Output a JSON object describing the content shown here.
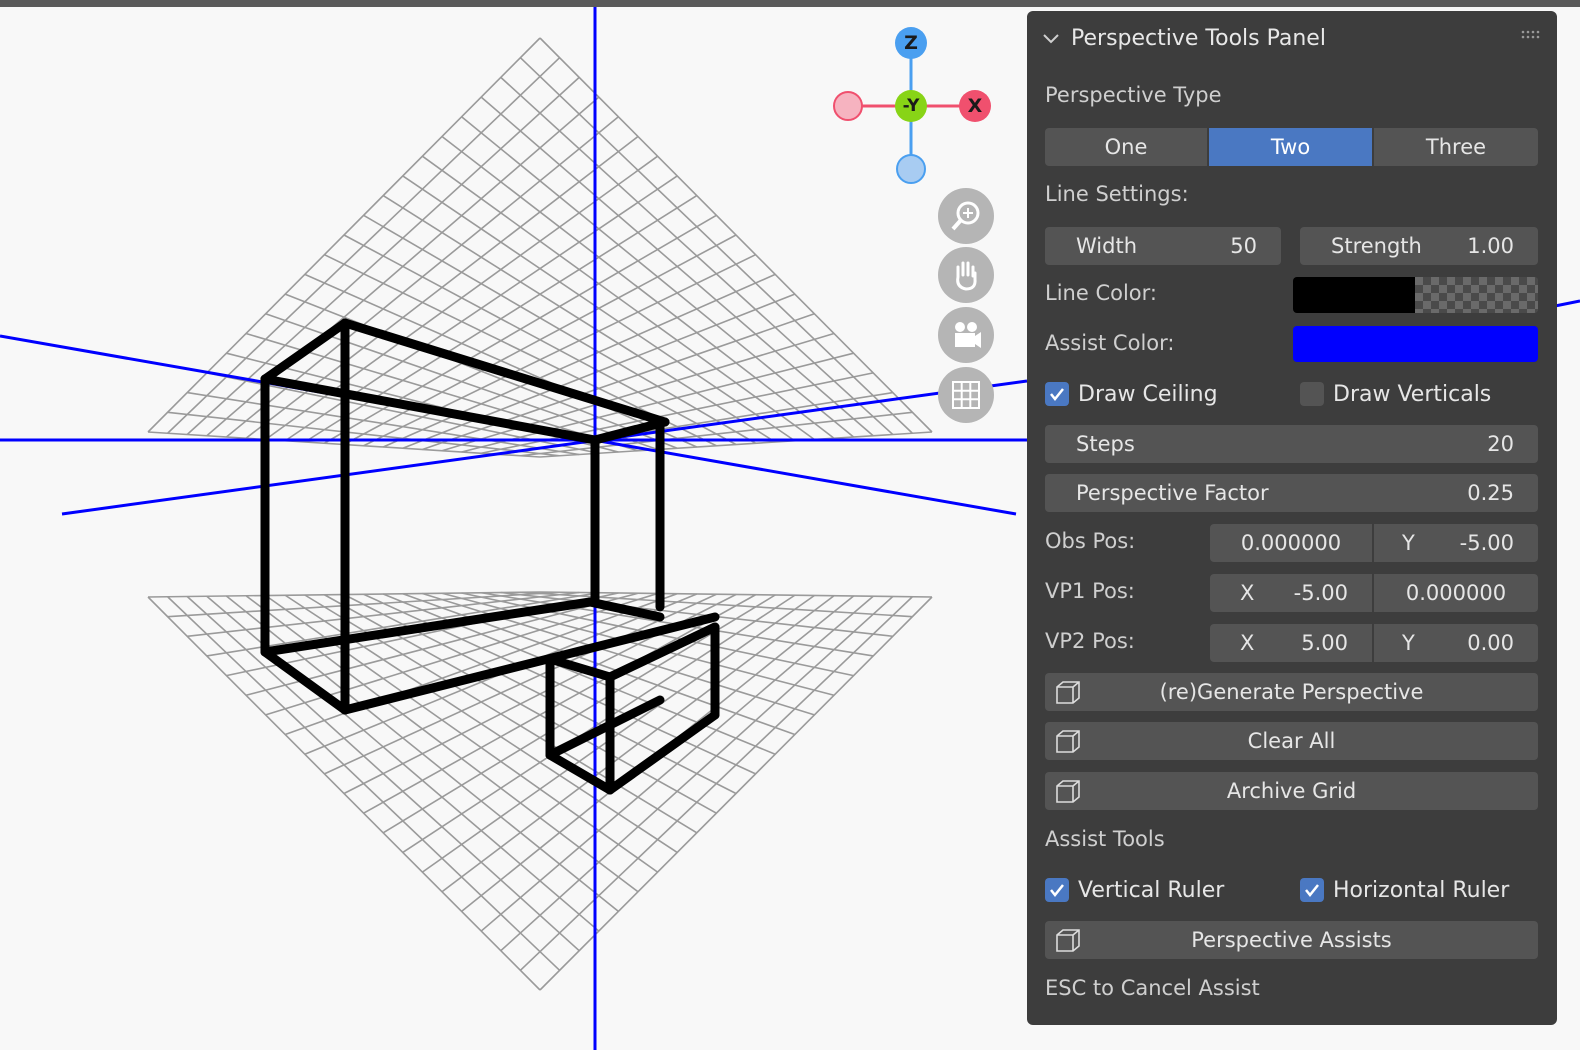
{
  "panel": {
    "title": "Perspective Tools Panel",
    "perspective_type_label": "Perspective Type",
    "type_options": [
      "One",
      "Two",
      "Three"
    ],
    "type_selected": "Two",
    "line_settings_label": "Line Settings:",
    "width_label": "Width",
    "width_value": "50",
    "strength_label": "Strength",
    "strength_value": "1.00",
    "line_color_label": "Line Color:",
    "line_color": "#000000",
    "assist_color_label": "Assist Color:",
    "assist_color": "#0000ff",
    "draw_ceiling_label": "Draw Ceiling",
    "draw_ceiling_checked": true,
    "draw_verticals_label": "Draw Verticals",
    "draw_verticals_checked": false,
    "steps_label": "Steps",
    "steps_value": "20",
    "perspective_factor_label": "Perspective Factor",
    "perspective_factor_value": "0.25",
    "obs_pos_label": "Obs Pos:",
    "obs_pos_x_value": "0.000000",
    "obs_pos_y_label": "Y",
    "obs_pos_y_value": "-5.00",
    "vp1_pos_label": "VP1 Pos:",
    "vp1_x_label": "X",
    "vp1_x_value": "-5.00",
    "vp1_y_value": "0.000000",
    "vp2_pos_label": "VP2 Pos:",
    "vp2_x_label": "X",
    "vp2_x_value": "5.00",
    "vp2_y_label": "Y",
    "vp2_y_value": "0.00",
    "regenerate_label": "(re)Generate Perspective",
    "clear_all_label": "Clear All",
    "archive_grid_label": "Archive Grid",
    "assist_tools_label": "Assist Tools",
    "vertical_ruler_label": "Vertical Ruler",
    "vertical_ruler_checked": true,
    "horizontal_ruler_label": "Horizontal Ruler",
    "horizontal_ruler_checked": true,
    "perspective_assists_label": "Perspective Assists",
    "esc_hint": "ESC to Cancel Assist"
  },
  "gizmo": {
    "z_label": "Z",
    "y_label": "-Y",
    "x_label": "X"
  },
  "nav_icons": [
    "zoom-icon",
    "pan-hand-icon",
    "camera-icon",
    "grid-view-icon"
  ],
  "colors": {
    "panel_bg": "#3d3d3d",
    "field_bg": "#545454",
    "accent": "#4a78c2",
    "assist_line": "#0000ff",
    "z_axis": "#4a9ff0",
    "x_axis": "#f0506e",
    "y_axis": "#88d416"
  }
}
